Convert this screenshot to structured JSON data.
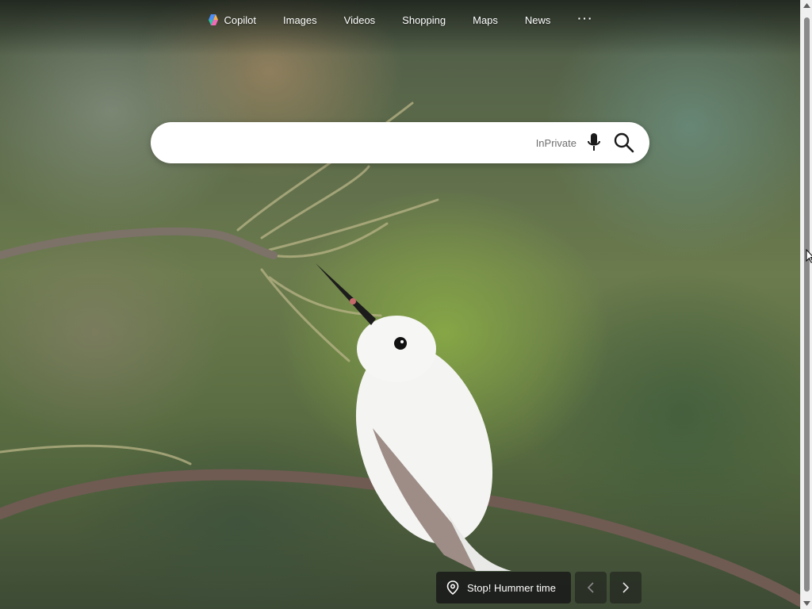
{
  "nav": {
    "items": [
      {
        "label": "Copilot",
        "icon": "copilot-icon"
      },
      {
        "label": "Images"
      },
      {
        "label": "Videos"
      },
      {
        "label": "Shopping"
      },
      {
        "label": "Maps"
      },
      {
        "label": "News"
      }
    ],
    "more_label": "···"
  },
  "search": {
    "value": "",
    "placeholder": "",
    "inprivate_label": "InPrivate",
    "mic_icon": "microphone-icon",
    "search_icon": "search-icon"
  },
  "background": {
    "caption": "Stop! Hummer time",
    "caption_icon": "location-pin-icon",
    "prev_icon": "chevron-left-icon",
    "next_icon": "chevron-right-icon"
  },
  "colors": {
    "searchbox": "#ffffff",
    "inprivate_text": "#6e6e6e",
    "caption_bg": "#191919"
  }
}
